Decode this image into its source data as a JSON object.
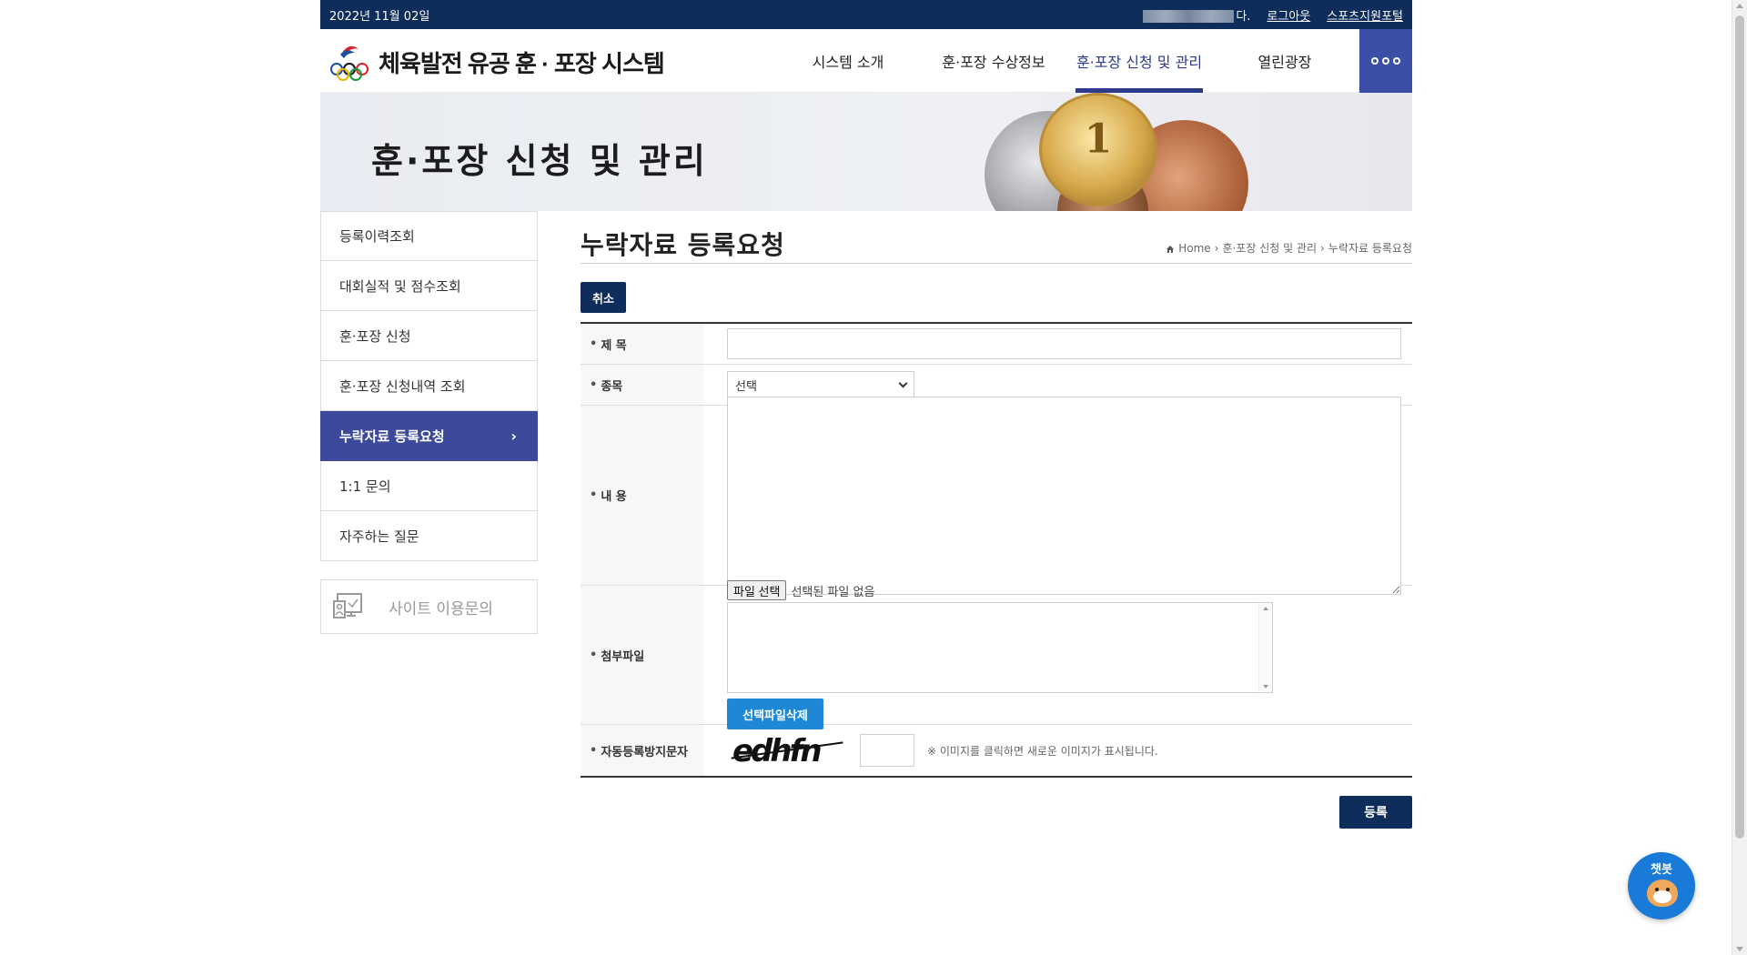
{
  "topbar": {
    "date": "2022년 11월 02일",
    "user_suffix": "다.",
    "logout": "로그아웃",
    "portal": "스포츠지원포털"
  },
  "header": {
    "logo_text": "체육발전 유공 훈 · 포장 시스템",
    "nav": [
      {
        "label": "시스템 소개"
      },
      {
        "label": "훈·포장 수상정보"
      },
      {
        "label": "훈·포장 신청 및 관리"
      },
      {
        "label": "열린광장"
      }
    ],
    "active_nav_index": 2
  },
  "banner": {
    "title": "훈·포장 신청 및 관리",
    "medal_number": "1"
  },
  "sidebar": {
    "items": [
      {
        "label": "등록이력조회"
      },
      {
        "label": "대회실적 및 점수조회"
      },
      {
        "label": "훈·포장 신청"
      },
      {
        "label": "훈·포장 신청내역 조회"
      },
      {
        "label": "누락자료 등록요청"
      },
      {
        "label": "1:1 문의"
      },
      {
        "label": "자주하는 질문"
      }
    ],
    "active_index": 4,
    "site_inquiry": "사이트 이용문의"
  },
  "content": {
    "title": "누락자료 등록요청",
    "breadcrumb": [
      "Home",
      "훈·포장 신청 및 관리",
      "누락자료 등록요청"
    ],
    "cancel_label": "취소",
    "form": {
      "title_label": "제 목",
      "title_value": "",
      "sport_label": "종목",
      "sport_selected": "선택",
      "content_label": "내 용",
      "content_value": "",
      "attachment_label": "첨부파일",
      "file_button": "파일 선택",
      "file_status": "선택된 파일 없음",
      "delete_selected_file": "선택파일삭제",
      "captcha_label": "자동등록방지문자",
      "captcha_text": "edhfn",
      "captcha_value": "",
      "captcha_note": "※ 이미지를 클릭하면 새로운 이미지가 표시됩니다."
    },
    "submit_label": "등록"
  },
  "chatbot": {
    "label": "챗봇"
  },
  "colors": {
    "topbar_bg": "#0e2d5a",
    "accent": "#3d4a9b",
    "nav_active": "#2e3a8c",
    "more_btn": "#3b4fa6",
    "delete_btn": "#1f88d6",
    "chatbot_bg": "#1a7ad8"
  }
}
